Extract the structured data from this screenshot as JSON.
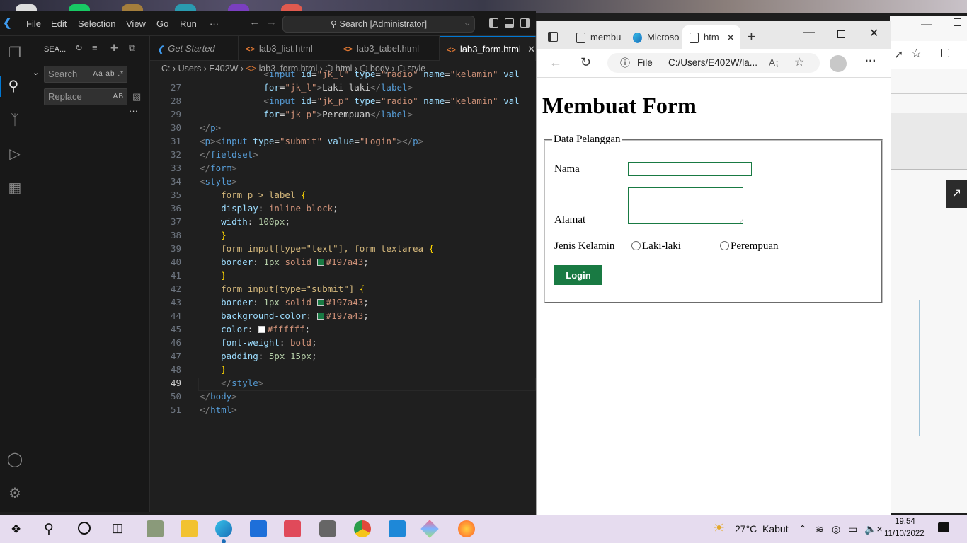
{
  "vscode": {
    "menu": [
      "File",
      "Edit",
      "Selection",
      "View",
      "Go",
      "Run",
      "···"
    ],
    "command_center": "Search [Administrator]",
    "sidebar": {
      "title": "SEA...",
      "search_placeholder": "Search",
      "replace_placeholder": "Replace",
      "search_opts": "Aa ab .*",
      "replace_opts": "AB"
    },
    "tabs": [
      {
        "label": "Get Started",
        "icon": "vscode-icon"
      },
      {
        "label": "lab3_list.html",
        "icon": "<>"
      },
      {
        "label": "lab3_tabel.html",
        "icon": "<>"
      },
      {
        "label": "lab3_form.html",
        "icon": "<>"
      }
    ],
    "breadcrumb": [
      "C:",
      "Users",
      "E402W",
      "lab3_form.html",
      "html",
      "body",
      "style"
    ],
    "current_line": 49,
    "line_numbers": [
      27,
      28,
      29,
      30,
      31,
      32,
      33,
      34,
      35,
      36,
      37,
      38,
      39,
      40,
      41,
      42,
      43,
      44,
      45,
      46,
      47,
      48,
      49,
      50,
      51
    ]
  },
  "browser": {
    "tabs": [
      {
        "label": "membu"
      },
      {
        "label": "Microso"
      },
      {
        "label": "htm"
      }
    ],
    "url_scheme": "File",
    "url": "C:/Users/E402W/la...",
    "page": {
      "title": "Membuat Form",
      "legend": "Data Pelanggan",
      "label_nama": "Nama",
      "label_alamat": "Alamat",
      "label_jk": "Jenis Kelamin",
      "radio_l": "Laki-laki",
      "radio_p": "Perempuan",
      "submit": "Login"
    }
  },
  "taskbar": {
    "temperature": "27°C",
    "weather": "Kabut",
    "time": "19.54",
    "date": "11/10/2022"
  },
  "colors": {
    "accent_green": "#197a43",
    "vscode_purple": "#68217a"
  }
}
